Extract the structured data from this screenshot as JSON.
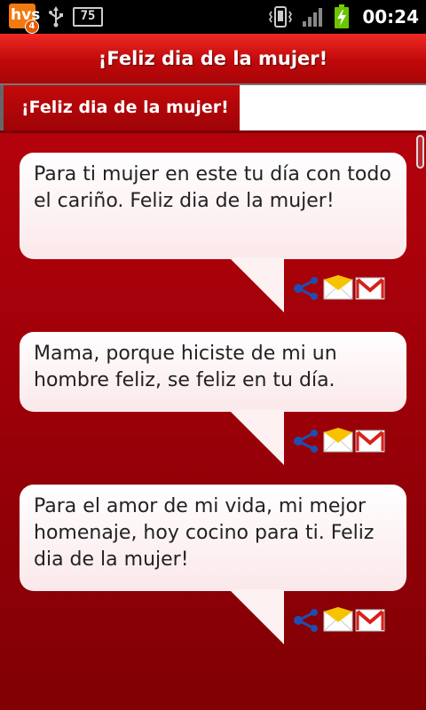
{
  "status_bar": {
    "app_badge_text": "hvs",
    "notification_count": "4",
    "keyboard_label": "75",
    "time": "00:24"
  },
  "header": {
    "title": "¡Feliz dia de la mujer!"
  },
  "tabs": [
    {
      "label": "¡Feliz dia de la mujer!",
      "active": true
    },
    {
      "label": "",
      "active": false
    }
  ],
  "messages": [
    {
      "text": "Para ti mujer en este tu día con todo el cariño. Feliz dia de la mujer!"
    },
    {
      "text": "Mama, porque hiciste de mi un hombre feliz, se feliz en tu día."
    },
    {
      "text": "Para el amor de mi vida, mi mejor homenaje, hoy cocino para ti. Feliz dia de la mujer!"
    }
  ],
  "action_icons": [
    "share-icon",
    "sms-envelope-icon",
    "gmail-icon"
  ],
  "colors": {
    "title_bar": "#d0120e",
    "background": "#9a0008",
    "bubble": "#fdf0f1"
  }
}
